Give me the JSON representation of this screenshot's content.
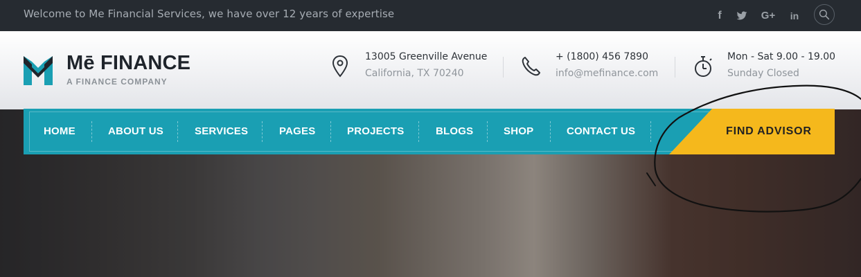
{
  "topbar": {
    "welcome_text": "Welcome to Me Financial Services, we have over 12 years of expertise",
    "social": {
      "facebook_glyph": "f",
      "gplus_glyph": "G+",
      "linkedin_glyph": "in"
    }
  },
  "header": {
    "brand": "Mē FINANCE",
    "tagline": "A FINANCE COMPANY",
    "address": {
      "line1": "13005 Greenville Avenue",
      "line2": "California, TX 70240",
      "icon": "map-pin-icon"
    },
    "contact": {
      "line1": "+ (1800) 456 7890",
      "line2": "info@mefinance.com",
      "icon": "phone-icon"
    },
    "hours": {
      "line1": "Mon - Sat 9.00 - 19.00",
      "line2": "Sunday Closed",
      "icon": "stopwatch-icon"
    }
  },
  "nav": {
    "items": [
      {
        "label": "HOME"
      },
      {
        "label": "ABOUT US"
      },
      {
        "label": "SERVICES"
      },
      {
        "label": "PAGES"
      },
      {
        "label": "PROJECTS"
      },
      {
        "label": "BLOGS"
      },
      {
        "label": "SHOP"
      },
      {
        "label": "CONTACT US"
      }
    ],
    "cta_label": "FIND ADVISOR"
  },
  "colors": {
    "accent": "#1a9fb3",
    "cta": "#f5b81c",
    "topbar": "#262b31",
    "brand_text": "#1f242b"
  }
}
